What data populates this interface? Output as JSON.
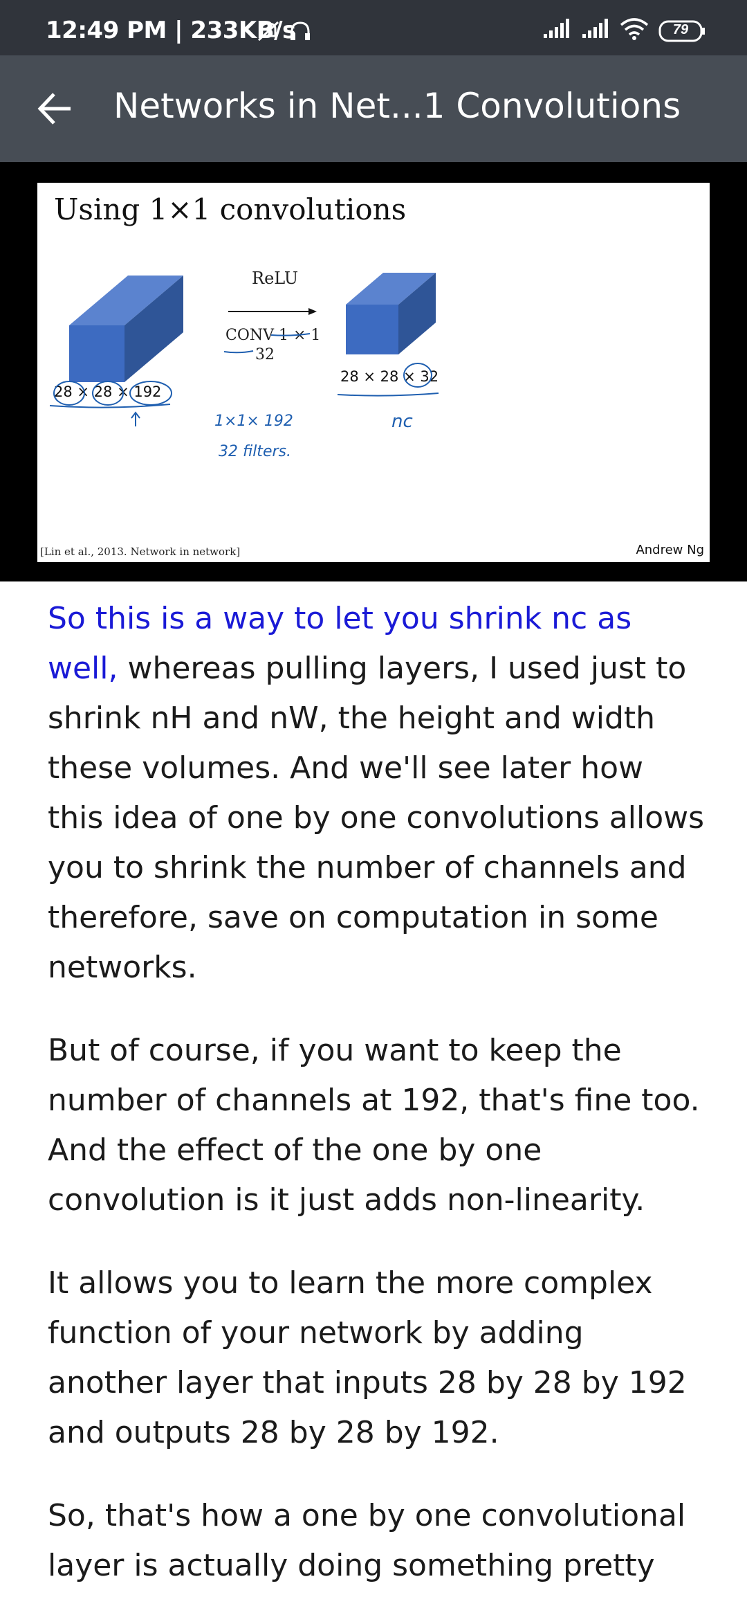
{
  "status_bar": {
    "time_speed": "12:49 PM | 233KB/s",
    "battery": "79"
  },
  "app_bar": {
    "title": "Networks in Net...1 Convolutions"
  },
  "slide": {
    "title": "Using 1×1 convolutions",
    "relu": "ReLU",
    "conv": "CONV 1 × 1",
    "filters": "32",
    "input_dims": "28 × 28 × 192",
    "output_dims": "28 × 28 × 32",
    "handwriting_1": "1×1× 192",
    "handwriting_2": "32 filters.",
    "handwriting_3": "nc",
    "citation": "[Lin et al., 2013. Network in network]",
    "author": "Andrew Ng"
  },
  "transcript": {
    "p1_highlight": "So this is a way to let you shrink nc as well,",
    "p1_rest": " whereas pulling layers, I used just to shrink nH and nW, the height and width these volumes. And we'll see later how this idea of one by one convolutions allows you to shrink the number of channels and therefore, save on computation in some networks.",
    "p2": "But of course, if you want to keep the number of channels at 192, that's fine too. And the effect of the one by one convolution is it just adds non-linearity.",
    "p3": "It allows you to learn the more complex function of your network by adding another layer that inputs 28 by 28 by 192 and outputs 28 by 28 by 192.",
    "p4": "So, that's how a one by one convolutional layer is actually doing something pretty"
  },
  "colors": {
    "status_bg": "#30343b",
    "appbar_bg": "#474d55",
    "highlight": "#1a1ad6",
    "cube_front": "#4472c4",
    "handwriting": "#1f5fb0"
  }
}
